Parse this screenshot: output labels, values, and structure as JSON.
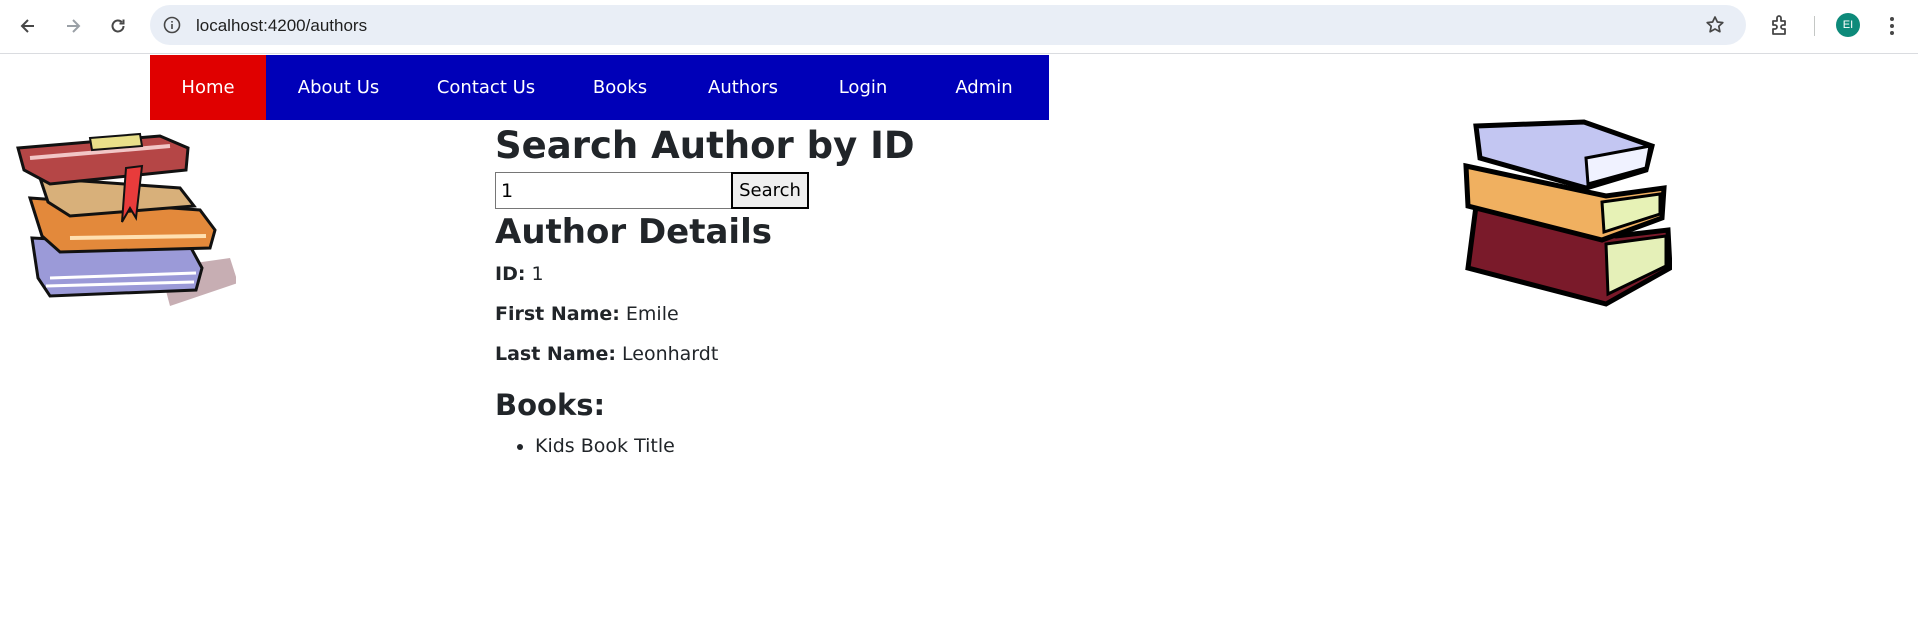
{
  "browser": {
    "url": "localhost:4200/authors",
    "avatar_initials": "EI",
    "icons": [
      "back-icon",
      "forward-icon",
      "reload-icon",
      "info-icon",
      "star-icon",
      "extensions-icon",
      "menu-icon"
    ]
  },
  "navbar": {
    "items": [
      {
        "label": "Home",
        "active": true
      },
      {
        "label": "About Us",
        "active": false
      },
      {
        "label": "Contact Us",
        "active": false
      },
      {
        "label": "Books",
        "active": false
      },
      {
        "label": "Authors",
        "active": false
      },
      {
        "label": "Login",
        "active": false
      },
      {
        "label": "Admin",
        "active": false
      }
    ],
    "colors": {
      "background": "#0000b8",
      "active": "#e00000"
    }
  },
  "search": {
    "heading": "Search Author by ID",
    "input_value": "1",
    "button_label": "Search"
  },
  "details": {
    "heading": "Author Details",
    "id_label": "ID:",
    "id_value": "1",
    "first_name_label": "First Name:",
    "first_name_value": "Emile",
    "last_name_label": "Last Name:",
    "last_name_value": "Leonhardt",
    "books_heading": "Books:",
    "books": [
      "Kids Book Title"
    ]
  }
}
